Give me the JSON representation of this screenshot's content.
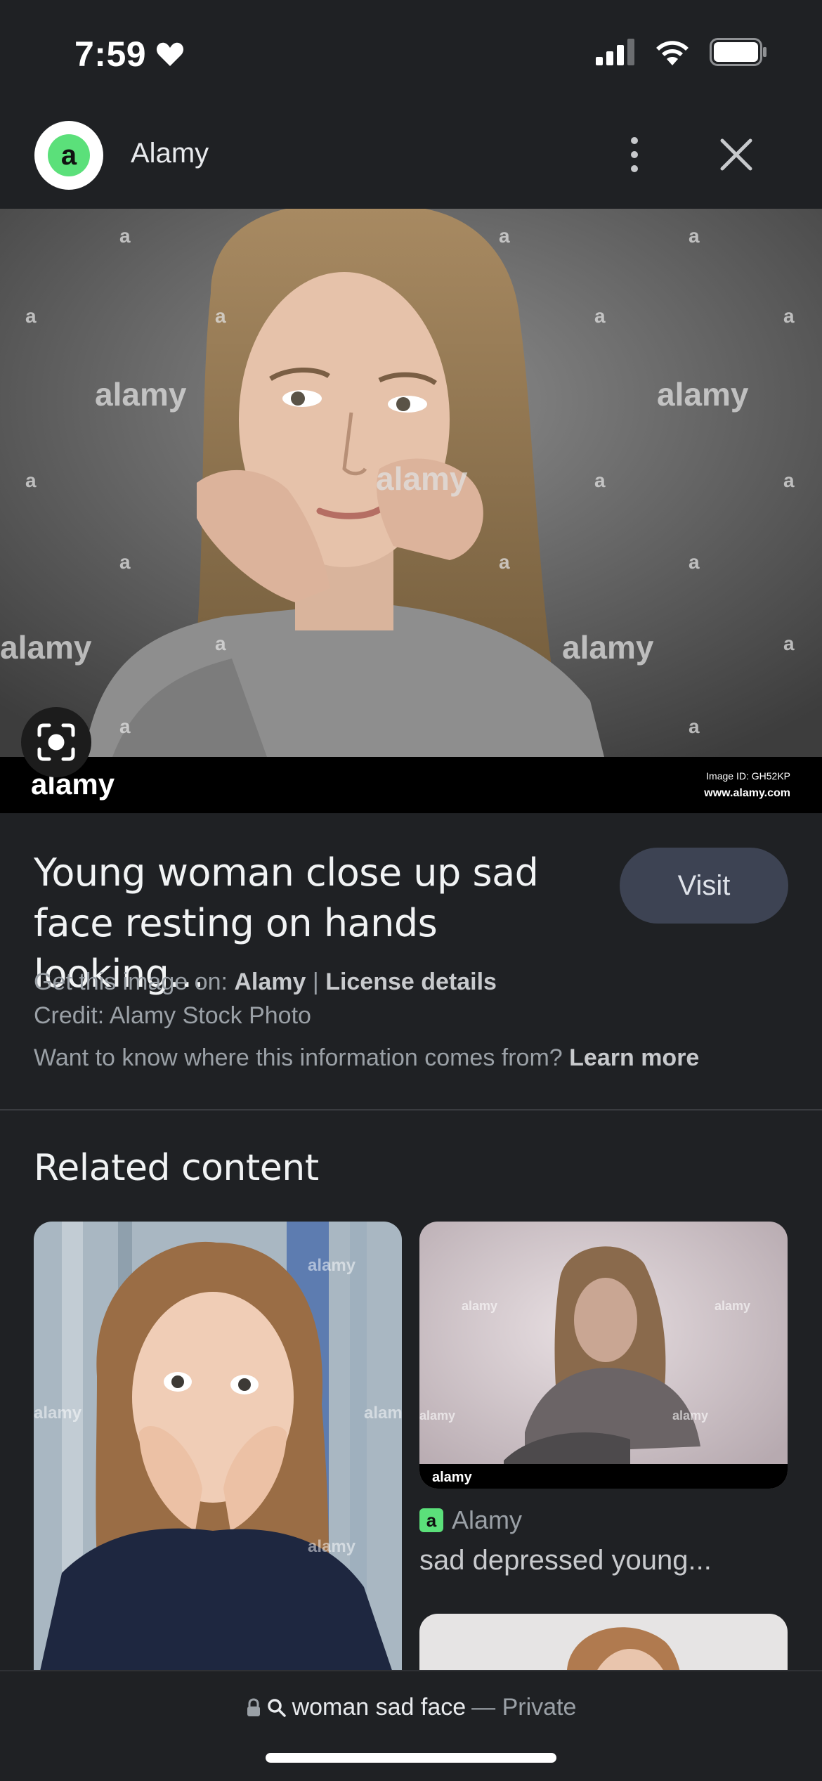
{
  "status_bar": {
    "time": "7:59",
    "heart_icon": "heart-icon",
    "signal_icon": "cellular-signal-icon",
    "wifi_icon": "wifi-icon",
    "battery_icon": "battery-icon"
  },
  "header": {
    "site_initial": "a",
    "site_name": "Alamy",
    "more_icon": "more-vert-icon",
    "close_icon": "close-icon"
  },
  "main_image": {
    "watermark": "alamy",
    "watermark_small": "a",
    "footer_logo": "alamy",
    "image_id": "Image ID: GH52KP",
    "site_url": "www.alamy.com",
    "lens_icon": "lens-icon"
  },
  "info": {
    "title": "Young woman close up sad face resting on hands looking...",
    "visit_label": "Visit",
    "get_image_prefix": "Get this image on:",
    "get_image_source": "Alamy",
    "separator": "|",
    "license_label": "License details",
    "credit": "Credit: Alamy Stock Photo",
    "info_question": "Want to know where this information comes from?",
    "learn_more": "Learn more"
  },
  "related": {
    "heading": "Related content",
    "item2_source": "Alamy",
    "item2_source_initial": "a",
    "item2_caption": "sad depressed young..."
  },
  "bottom_bar": {
    "query": "woman sad face",
    "suffix": "— Private",
    "lock_icon": "lock-icon",
    "search_icon": "search-icon"
  },
  "colors": {
    "background": "#1f2124",
    "visit_button": "#3d4353",
    "brand_green": "#5be07a"
  }
}
